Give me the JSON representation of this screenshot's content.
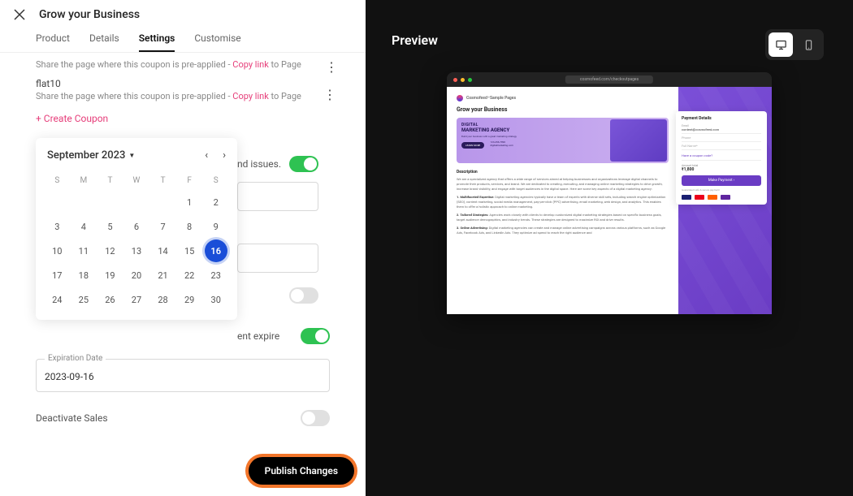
{
  "header": {
    "title": "Grow your Business"
  },
  "tabs": {
    "product": "Product",
    "details": "Details",
    "settings": "Settings",
    "customise": "Customise"
  },
  "coupons": {
    "share_prefix": "Share the page where this coupon is pre-applied - ",
    "copy_link": "Copy link",
    "to_page": " to Page",
    "flat10": "flat10",
    "create": "+ Create Coupon"
  },
  "calendar": {
    "month_label": "September 2023",
    "dow": [
      "S",
      "M",
      "T",
      "W",
      "T",
      "F",
      "S"
    ],
    "leading_blanks": 5,
    "days": 30,
    "selected": 16
  },
  "behind": {
    "issues_text": "nd issues.",
    "expire_text": "ent expire"
  },
  "expiration": {
    "legend": "Expiration Date",
    "value": "2023-09-16"
  },
  "deactivate": {
    "label": "Deactivate Sales"
  },
  "publish": {
    "label": "Publish Changes"
  },
  "preview": {
    "title": "Preview",
    "url": "cosmofeed.com/checkoutpages",
    "brand": "Cosmofeed–Sample Pages",
    "page_title": "Grow your Business",
    "banner": {
      "line1": "DIGITAL",
      "line2": "MARKETING AGENCY",
      "tag": "Build your business with a great marketing strategy",
      "cta": "LEARN MORE",
      "contact1": "123-456-7890",
      "contact2": "digitalmarketing.com"
    },
    "desc_h": "Description",
    "desc1": "We are a specialized agency that offers a wide range of services aimed at helping businesses and organizations leverage digital channels to promote their products, services, and brand. We are dedicated to creating, executing, and managing online marketing strategies to drive growth, increase brand visibility, and engage with target audiences in the digital space. Here are some key aspects of a digital marketing agency:",
    "desc2_b": "1. Multifaceted Expertise:",
    "desc2": " Digital marketing agencies typically have a team of experts with diverse skill sets, including search engine optimization (SEO), content marketing, social media management, pay-per-click (PPC) advertising, email marketing, web design, and analytics. This enables them to offer a holistic approach to online marketing.",
    "desc3_b": "2. Tailored Strategies:",
    "desc3": " Agencies work closely with clients to develop customized digital marketing strategies based on specific business goals, target audience demographics, and industry trends. These strategies are designed to maximize ROI and drive results.",
    "desc4_b": "3. Online Advertising:",
    "desc4": " Digital marketing agencies can create and manage online advertising campaigns across various platforms, such as Google Ads, Facebook Ads, and LinkedIn Ads. They optimize ad spend to reach the right audience and",
    "payment": {
      "title": "Payment Details",
      "email_label": "Email",
      "email": "content@cosmofeed.com",
      "phone": "Phone",
      "fullname": "Full Name*",
      "coupon": "Have a coupon code?",
      "amount_label": "Amount total",
      "amount": "₹1,800",
      "button": "Make Payment ›",
      "secure": "Guaranteed safe & secure payment"
    }
  }
}
